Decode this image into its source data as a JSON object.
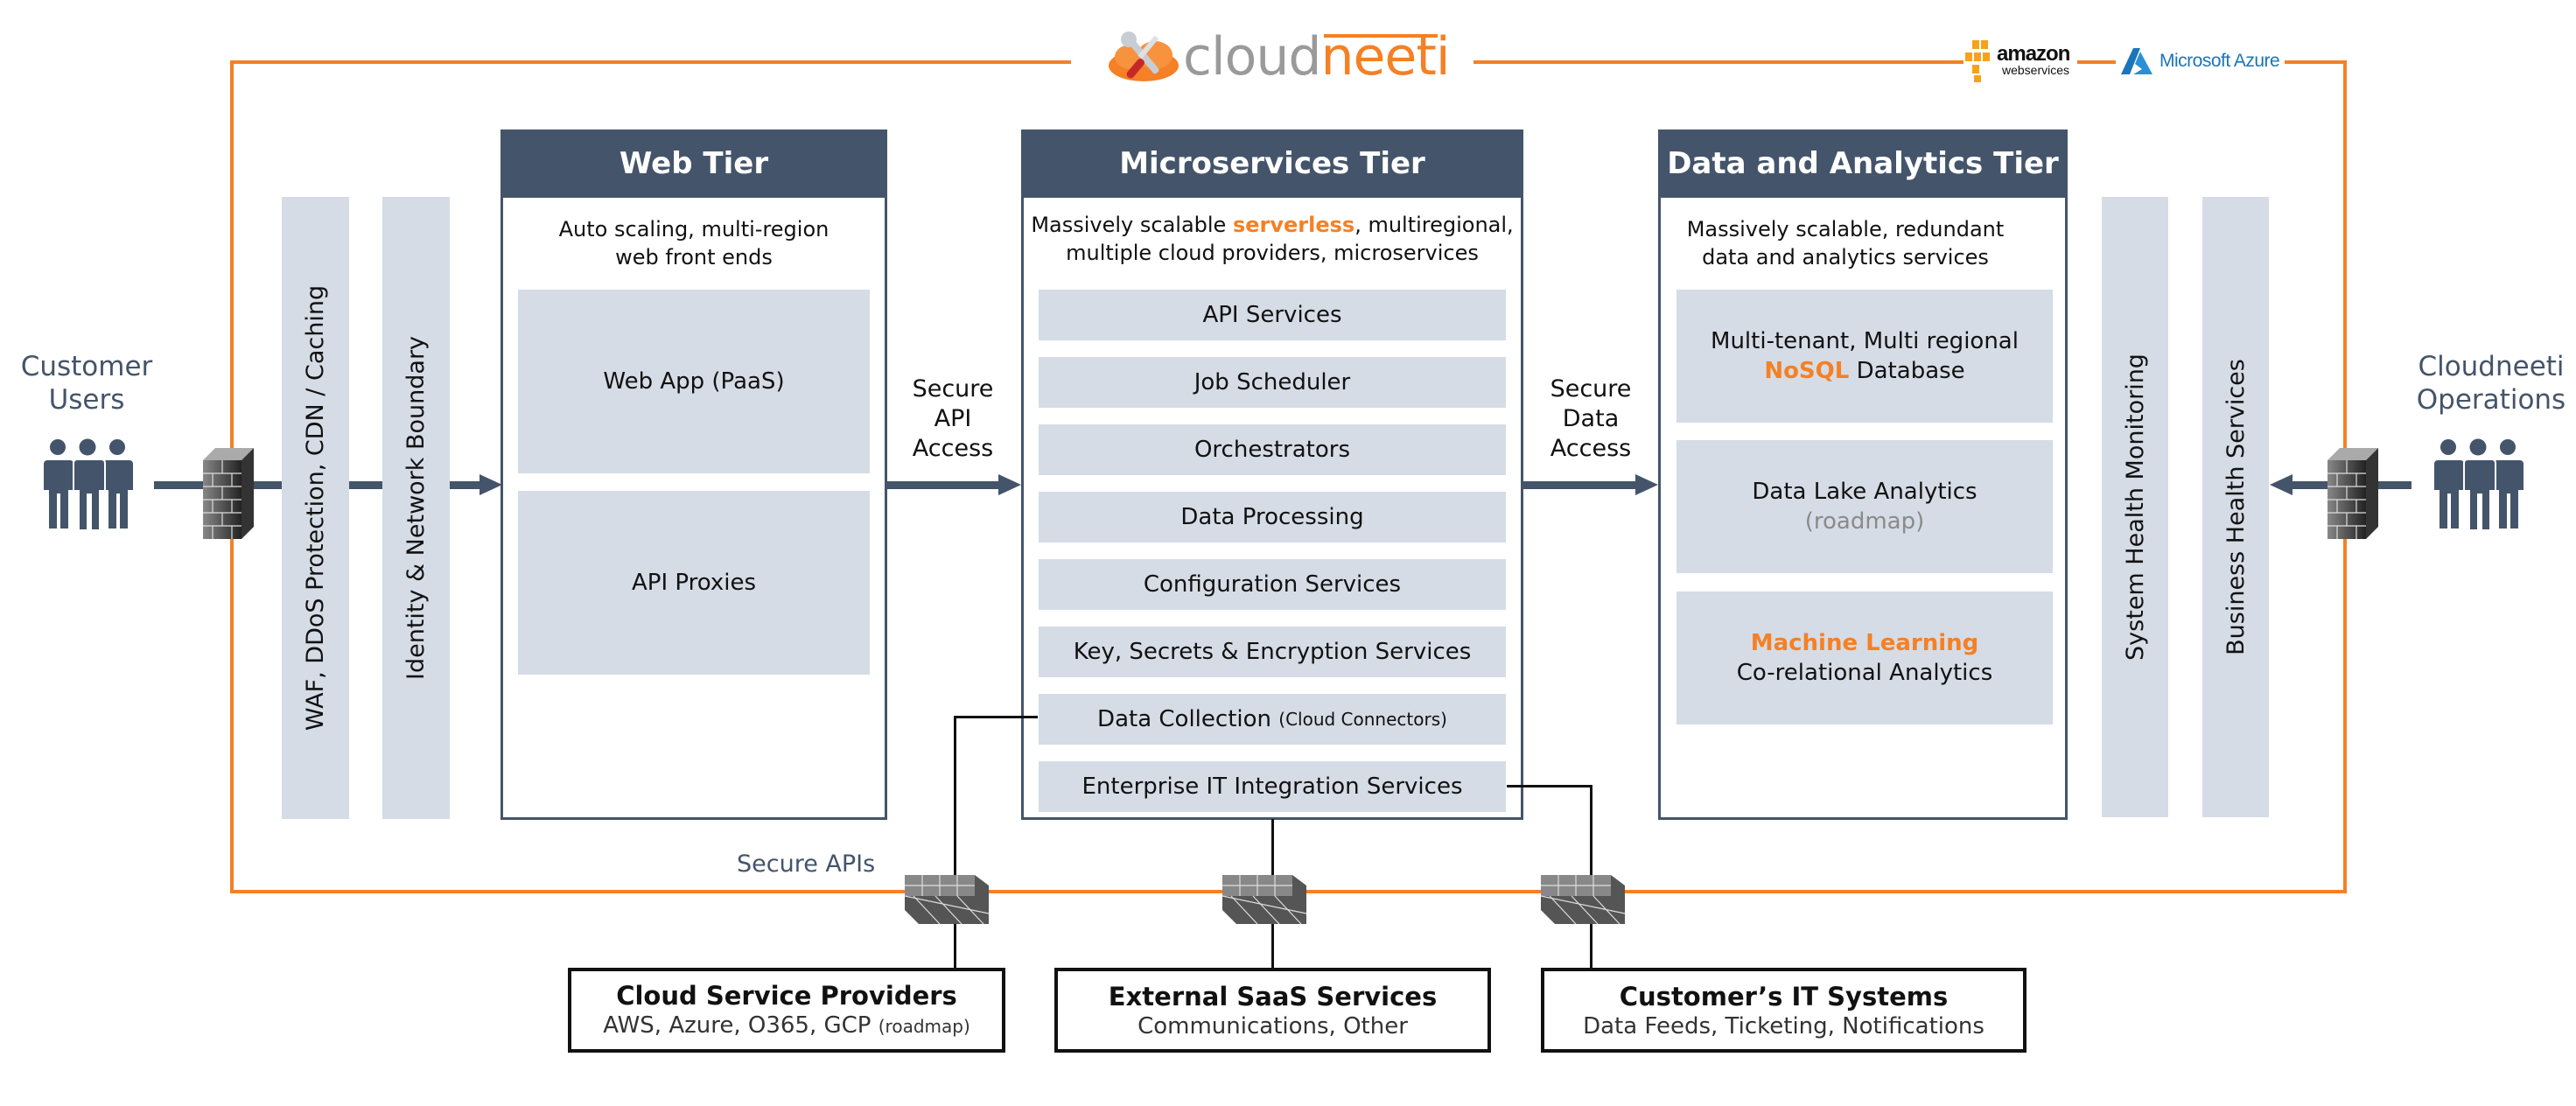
{
  "brand": {
    "logo_part1": "cloud",
    "logo_part2": "neeti",
    "partners": {
      "aws_name": "amazon",
      "aws_sub": "webservices",
      "azure_name": "Microsoft Azure"
    },
    "colors": {
      "accent_orange": "#f58025",
      "tier_header": "#44546a",
      "cell_fill": "#d5dce6",
      "actor_color": "#44546a"
    }
  },
  "actors": {
    "left": {
      "line1": "Customer",
      "line2": "Users",
      "icon": "users-group-icon"
    },
    "right": {
      "line1": "Cloudneeti",
      "line2": "Operations",
      "icon": "users-group-icon"
    }
  },
  "bands": {
    "left": [
      "WAF, DDoS Protection, CDN / Caching",
      "Identity & Network Boundary"
    ],
    "right": [
      "System Health Monitoring",
      "Business Health Services"
    ]
  },
  "arrows": {
    "api_access": [
      "Secure",
      "API",
      "Access"
    ],
    "data_access": [
      "Secure",
      "Data",
      "Access"
    ],
    "secure_apis": "Secure APIs"
  },
  "web_tier": {
    "title": "Web Tier",
    "desc_line1": "Auto scaling, multi-region",
    "desc_line2": "web front ends",
    "items": [
      "Web App (PaaS)",
      "API Proxies"
    ]
  },
  "micro_tier": {
    "title": "Microservices Tier",
    "desc_pre": "Massively scalable ",
    "desc_highlight": "serverless",
    "desc_post": ", multiregional,",
    "desc_line2": "multiple cloud providers, microservices",
    "items": [
      {
        "label": "API Services",
        "note": ""
      },
      {
        "label": "Job Scheduler",
        "note": ""
      },
      {
        "label": "Orchestrators",
        "note": ""
      },
      {
        "label": "Data Processing",
        "note": ""
      },
      {
        "label": "Configuration Services",
        "note": ""
      },
      {
        "label": "Key, Secrets & Encryption Services",
        "note": ""
      },
      {
        "label": "Data Collection ",
        "note": "(Cloud Connectors)"
      },
      {
        "label": "Enterprise IT Integration Services",
        "note": ""
      }
    ]
  },
  "data_tier": {
    "title": "Data and Analytics Tier",
    "desc_line1": "Massively scalable, redundant",
    "desc_line2": "data and analytics services",
    "items": [
      {
        "line1": "Multi-tenant, Multi regional",
        "line2_highlight": "NoSQL",
        "line2_rest": " Database"
      },
      {
        "line1": "Data Lake Analytics",
        "line2_muted": "(roadmap)"
      },
      {
        "line1_highlight": "Machine Learning",
        "line2": "Co-relational Analytics"
      }
    ]
  },
  "external": [
    {
      "title": "Cloud Service Providers",
      "sub": "AWS, Azure, O365, GCP ",
      "sub_note": "(roadmap)"
    },
    {
      "title": "External SaaS Services",
      "sub": "Communications, Other",
      "sub_note": ""
    },
    {
      "title": "Customer’s IT Systems",
      "sub": "Data Feeds, Ticketing, Notifications",
      "sub_note": ""
    }
  ]
}
